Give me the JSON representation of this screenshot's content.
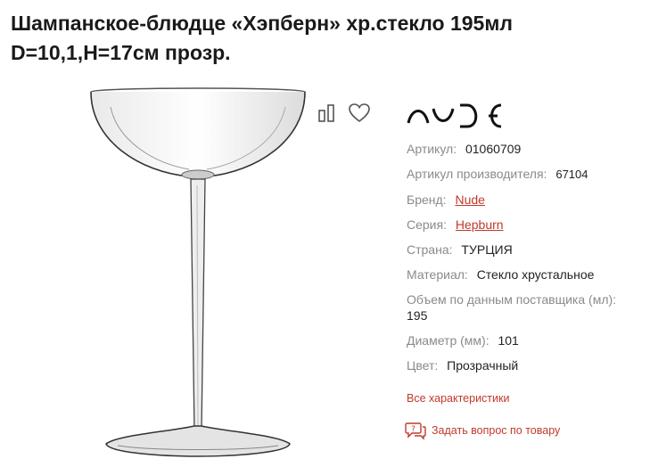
{
  "product": {
    "title_line1": "Шампанское-блюдце «Хэпберн» хр.стекло 195мл",
    "title_line2": "D=10,1,H=17см прозр."
  },
  "actions": {
    "compare_icon": "compare-icon",
    "favorite_icon": "heart-icon"
  },
  "brand_logo": "NUDE",
  "specs": {
    "article": {
      "label": "Артикул:",
      "value": "01060709"
    },
    "manufacturer_article": {
      "label": "Артикул производителя:",
      "value": "67104"
    },
    "brand": {
      "label": "Бренд:",
      "value": "Nude"
    },
    "series": {
      "label": "Серия:",
      "value": "Hepburn"
    },
    "country": {
      "label": "Страна:",
      "value": "ТУРЦИЯ"
    },
    "material": {
      "label": "Материал:",
      "value": "Стекло хрустальное"
    },
    "volume": {
      "label": "Объем по данным поставщика (мл):",
      "value": "195"
    },
    "diameter": {
      "label": "Диаметр (мм):",
      "value": "101"
    },
    "color": {
      "label": "Цвет:",
      "value": "Прозрачный"
    }
  },
  "links": {
    "all_specs": "Все характеристики",
    "ask_question": "Задать вопрос по товару"
  },
  "colors": {
    "accent": "#c0392b",
    "label": "#8a8a8a",
    "text": "#222222"
  }
}
